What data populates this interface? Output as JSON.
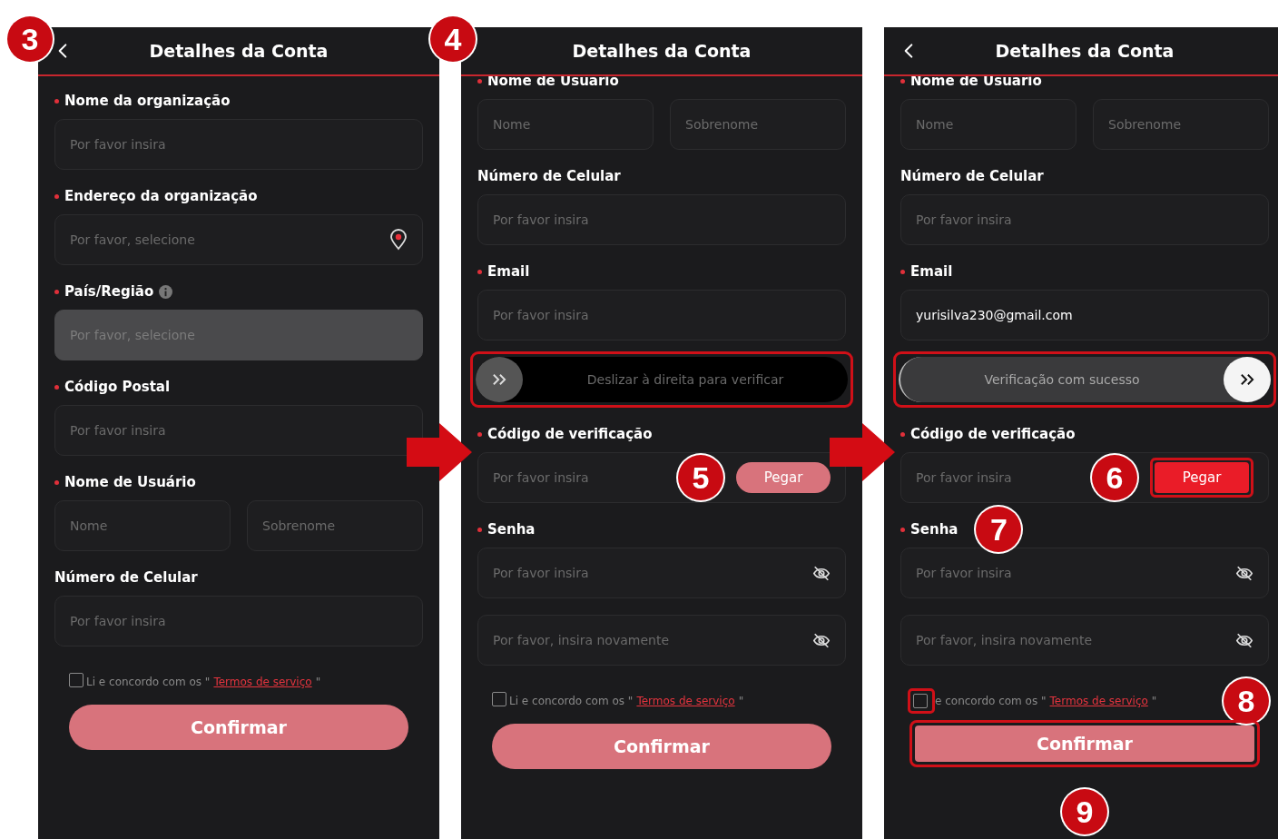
{
  "panels": [
    {
      "title": "Detalhes da Conta",
      "back": true,
      "scrolled": false,
      "badge": "3",
      "items": [
        {
          "kind": "text",
          "label": "Nome da organização",
          "required": true,
          "placeholder": "Por favor insira"
        },
        {
          "kind": "select",
          "label": "Endereço da organização",
          "required": true,
          "placeholder": "Por favor, selecione",
          "disabled": false
        },
        {
          "kind": "select",
          "label": "País/Região",
          "required": true,
          "info": true,
          "placeholder": "Por favor, selecione",
          "disabled": true
        },
        {
          "kind": "text",
          "label": "Código Postal",
          "required": true,
          "placeholder": "Por favor insira"
        },
        {
          "kind": "split",
          "label": "Nome de Usuário",
          "required": true,
          "placeholders": [
            "Nome",
            "Sobrenome"
          ]
        },
        {
          "kind": "text",
          "label": "Número de Celular",
          "required": false,
          "placeholder": "Por favor insira"
        }
      ],
      "terms": {
        "prefix": "Li e concordo com os \"",
        "link": "Termos de serviço",
        "suffix": "\"",
        "checked": false,
        "highlight": false
      },
      "confirm": {
        "label": "Confirmar",
        "enabled": false,
        "highlight": false
      }
    },
    {
      "title": "Detalhes da Conta",
      "back": false,
      "scrolled": true,
      "badge": "4",
      "items": [
        {
          "kind": "split",
          "label": "Nome de Usuário",
          "required": true,
          "placeholders": [
            "Nome",
            "Sobrenome"
          ]
        },
        {
          "kind": "text",
          "label": "Número de Celular",
          "required": false,
          "placeholder": "Por favor insira"
        },
        {
          "kind": "text",
          "label": "Email",
          "required": true,
          "placeholder": "Por favor insira"
        },
        {
          "kind": "slider",
          "text": "Deslizar à direita para verificar",
          "verified": false,
          "highlight": true
        },
        {
          "kind": "code",
          "label": "Código de verificação",
          "required": true,
          "placeholder": "Por favor insira",
          "button": "Pegar",
          "enabled": false,
          "highlight": false,
          "badge": "5"
        },
        {
          "kind": "password",
          "label": "Senha",
          "required": true,
          "placeholder": "Por favor insira"
        },
        {
          "kind": "password",
          "placeholder": "Por favor, insira novamente"
        }
      ],
      "terms": {
        "prefix": "Li e concordo com os \"",
        "link": "Termos de serviço",
        "suffix": "\"",
        "checked": false,
        "highlight": false
      },
      "confirm": {
        "label": "Confirmar",
        "enabled": false,
        "highlight": false
      }
    },
    {
      "title": "Detalhes da Conta",
      "back": true,
      "scrolled": true,
      "items": [
        {
          "kind": "split",
          "label": "Nome de Usuário",
          "required": true,
          "placeholders": [
            "Nome",
            "Sobrenome"
          ]
        },
        {
          "kind": "text",
          "label": "Número de Celular",
          "required": false,
          "placeholder": "Por favor insira"
        },
        {
          "kind": "text",
          "label": "Email",
          "required": true,
          "value": "yurisilva230@gmail.com"
        },
        {
          "kind": "slider",
          "text": "Verificação com sucesso",
          "verified": true,
          "highlight": true
        },
        {
          "kind": "code",
          "label": "Código de verificação",
          "required": true,
          "placeholder": "Por favor insira",
          "button": "Pegar",
          "enabled": true,
          "highlight": true,
          "badge": "6"
        },
        {
          "kind": "password",
          "label": "Senha",
          "required": true,
          "placeholder": "Por favor insira",
          "badge": "7"
        },
        {
          "kind": "password",
          "placeholder": "Por favor, insira novamente"
        }
      ],
      "terms": {
        "prefix": "e concordo com os \"",
        "link": "Termos de serviço",
        "suffix": "\"",
        "checked": false,
        "highlight": true,
        "badge": "8"
      },
      "confirm": {
        "label": "Confirmar",
        "enabled": false,
        "highlight": true,
        "badge": "9"
      }
    }
  ]
}
